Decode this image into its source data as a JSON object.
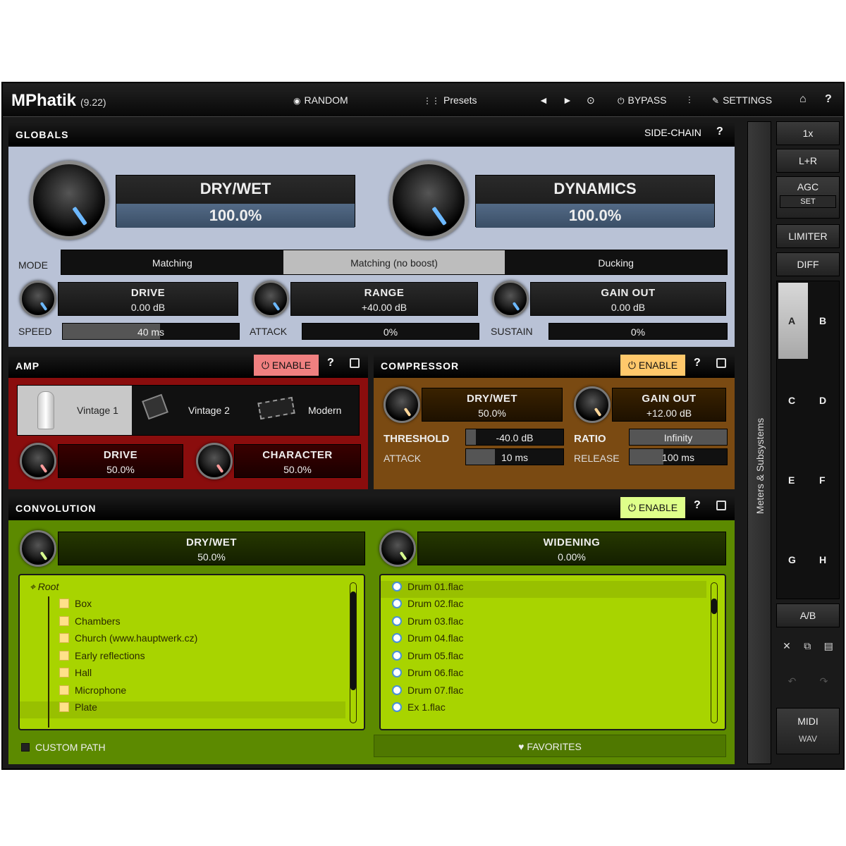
{
  "app": {
    "title": "MPhatik",
    "version": "(9.22)"
  },
  "toolbar": {
    "random": "RANDOM",
    "presets": "Presets",
    "prev": "◄",
    "next": "►",
    "dice": "⊙",
    "bypass": "BYPASS",
    "ms": "⫶",
    "settings": "SETTINGS",
    "home": "⌂",
    "help": "?"
  },
  "globals": {
    "title": "GLOBALS",
    "sidechain": "SIDE-CHAIN",
    "help": "?",
    "drywet": {
      "label": "DRY/WET",
      "value": "100.0%"
    },
    "dynamics": {
      "label": "DYNAMICS",
      "value": "100.0%"
    },
    "mode_label": "MODE",
    "modes": [
      "Matching",
      "Matching (no boost)",
      "Ducking"
    ],
    "mode_selected": 1,
    "drive": {
      "label": "DRIVE",
      "value": "0.00 dB"
    },
    "range": {
      "label": "RANGE",
      "value": "+40.00 dB"
    },
    "gainout": {
      "label": "GAIN OUT",
      "value": "0.00 dB"
    },
    "speed": {
      "label": "SPEED",
      "value": "40 ms",
      "fill": 0.55
    },
    "attack": {
      "label": "ATTACK",
      "value": "0%",
      "fill": 0
    },
    "sustain": {
      "label": "SUSTAIN",
      "value": "0%",
      "fill": 0
    }
  },
  "amp": {
    "title": "AMP",
    "enable": "ENABLE",
    "help": "?",
    "types": [
      "Vintage 1",
      "Vintage 2",
      "Modern"
    ],
    "drive": {
      "label": "DRIVE",
      "value": "50.0%"
    },
    "character": {
      "label": "CHARACTER",
      "value": "50.0%"
    }
  },
  "compressor": {
    "title": "COMPRESSOR",
    "enable": "ENABLE",
    "help": "?",
    "drywet": {
      "label": "DRY/WET",
      "value": "50.0%"
    },
    "gainout": {
      "label": "GAIN OUT",
      "value": "+12.00 dB"
    },
    "threshold": {
      "label": "THRESHOLD",
      "value": "-40.0 dB",
      "fill": 0.1
    },
    "ratio": {
      "label": "RATIO",
      "value": "Infinity",
      "fill": 1
    },
    "attack": {
      "label": "ATTACK",
      "value": "10 ms",
      "fill": 0.3
    },
    "release": {
      "label": "RELEASE",
      "value": "100 ms",
      "fill": 0.35
    }
  },
  "convolution": {
    "title": "CONVOLUTION",
    "enable": "ENABLE",
    "help": "?",
    "drywet": {
      "label": "DRY/WET",
      "value": "50.0%"
    },
    "widening": {
      "label": "WIDENING",
      "value": "0.00%"
    },
    "root": "Root",
    "folders": [
      "Box",
      "Chambers",
      "Church (www.hauptwerk.cz)",
      "Early reflections",
      "Hall",
      "Microphone",
      "Plate"
    ],
    "files": [
      "Drum 01.flac",
      "Drum 02.flac",
      "Drum 03.flac",
      "Drum 04.flac",
      "Drum 05.flac",
      "Drum 06.flac",
      "Drum 07.flac",
      "Ex 1.flac"
    ],
    "custom_path": "CUSTOM PATH",
    "favorites": "FAVORITES"
  },
  "side": {
    "meters": "Meters & Subsystems",
    "x1": "1x",
    "lr": "L+R",
    "agc": "AGC",
    "set": "SET",
    "limiter": "LIMITER",
    "diff": "DIFF",
    "slots": [
      "A",
      "B",
      "C",
      "D",
      "E",
      "F",
      "G",
      "H"
    ],
    "ab": "A/B",
    "midi": "MIDI",
    "wav": "WAV"
  },
  "colors": {
    "globals_bg": "#b9c2d6",
    "amp_bg": "#8a0d0d",
    "comp_bg": "#7a4a12",
    "conv_bg": "#5c8a00",
    "enable_amp": "#f08080",
    "enable_comp": "#ffc86b",
    "enable_conv": "#dfff8a",
    "list_bg": "#a8d400"
  }
}
